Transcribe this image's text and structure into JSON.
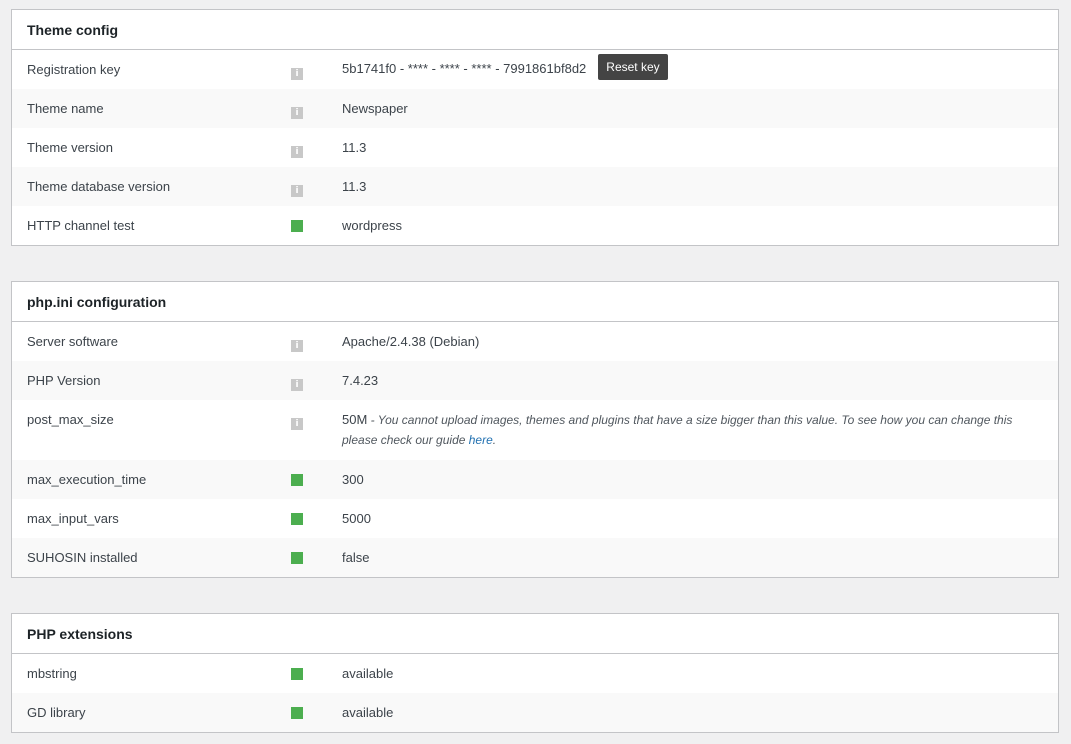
{
  "theme_config": {
    "title": "Theme config",
    "rows": [
      {
        "label": "Registration key",
        "status": "info",
        "value": "5b1741f0 - **** - **** - **** - 7991861bf8d2",
        "button": "Reset key"
      },
      {
        "label": "Theme name",
        "status": "info",
        "value": "Newspaper"
      },
      {
        "label": "Theme version",
        "status": "info",
        "value": "11.3"
      },
      {
        "label": "Theme database version",
        "status": "info",
        "value": "11.3"
      },
      {
        "label": "HTTP channel test",
        "status": "ok",
        "value": "wordpress"
      }
    ]
  },
  "php_ini": {
    "title": "php.ini configuration",
    "rows": [
      {
        "label": "Server software",
        "status": "info",
        "value": "Apache/2.4.38 (Debian)"
      },
      {
        "label": "PHP Version",
        "status": "info",
        "value": "7.4.23"
      },
      {
        "label": "post_max_size",
        "status": "info",
        "value": "50M",
        "note": " - You cannot upload images, themes and plugins that have a size bigger than this value. To see how you can change this please check our guide ",
        "link": "here",
        "note_end": "."
      },
      {
        "label": "max_execution_time",
        "status": "ok",
        "value": "300"
      },
      {
        "label": "max_input_vars",
        "status": "ok",
        "value": "5000"
      },
      {
        "label": "SUHOSIN installed",
        "status": "ok",
        "value": "false"
      }
    ]
  },
  "php_extensions": {
    "title": "PHP extensions",
    "rows": [
      {
        "label": "mbstring",
        "status": "ok",
        "value": "available"
      },
      {
        "label": "GD library",
        "status": "ok",
        "value": "available"
      }
    ]
  },
  "icons": {
    "info": "info-icon",
    "ok": "status-ok-icon",
    "info_glyph": "i"
  },
  "colors": {
    "ok": "#4cae4f",
    "info": "#c8c8c8",
    "button": "#444444"
  }
}
